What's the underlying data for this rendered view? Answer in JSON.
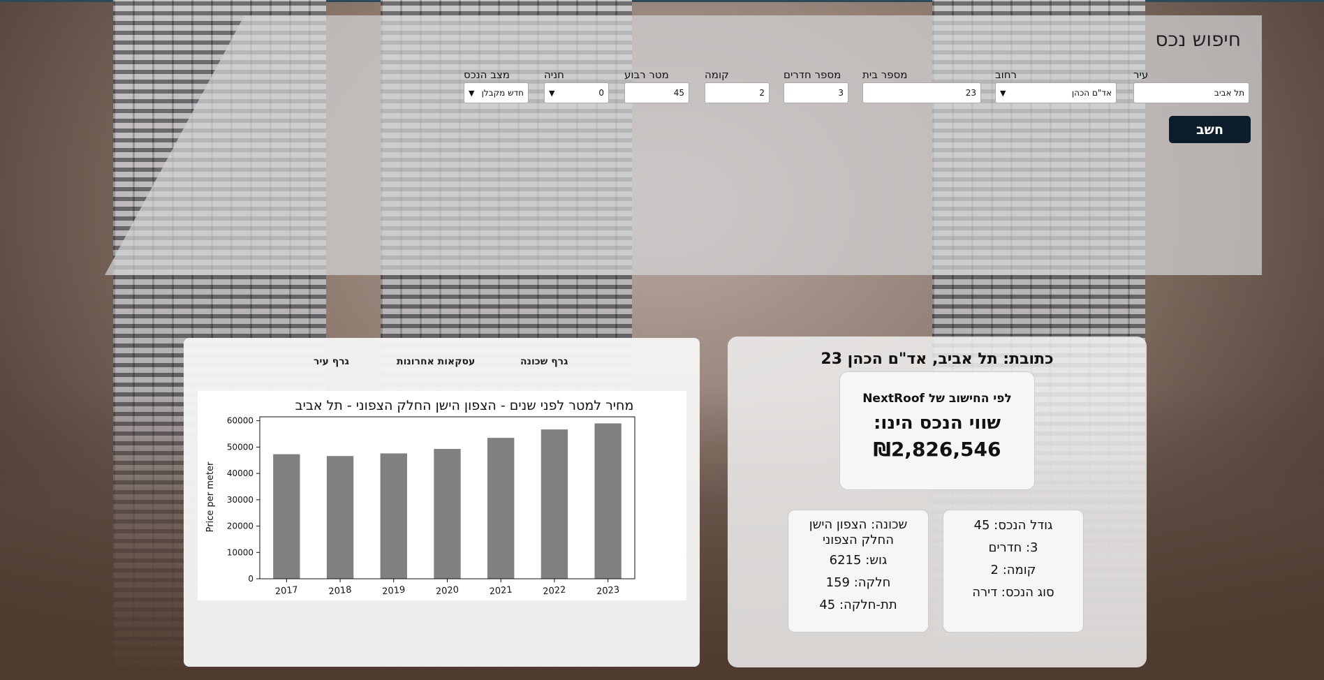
{
  "search": {
    "title": "חיפוש נכס",
    "fields": [
      {
        "label": "עיר",
        "value": "תל אביב"
      },
      {
        "label": "רחוב",
        "value": "אד\"ם הכהן"
      },
      {
        "label": "מספר בית",
        "value": "23"
      },
      {
        "label": "מספר חדרים",
        "value": "3"
      },
      {
        "label": "קומה",
        "value": "2"
      },
      {
        "label": "מטר רבוע",
        "value": "45"
      },
      {
        "label": "חניה",
        "value": "0"
      },
      {
        "label": "מצב הנכס",
        "value": "חדש מקבלן"
      }
    ],
    "calc_label": "חשב"
  },
  "tabs": [
    "גרף שכונה",
    "עסקאות אחרונות",
    "גרף עיר"
  ],
  "chart_data": {
    "type": "bar",
    "title": "מחיר למטר לפני שנים - הצפון הישן החלק הצפוני - תל אביב",
    "xlabel": "",
    "ylabel": "Price per meter",
    "categories": [
      "2017",
      "2018",
      "2019",
      "2020",
      "2021",
      "2022",
      "2023"
    ],
    "values": [
      47300,
      46600,
      47600,
      49300,
      53500,
      56700,
      59000
    ],
    "yticks": [
      "0",
      "10000",
      "20000",
      "30000",
      "40000",
      "50000",
      "60000"
    ],
    "ylim": [
      0,
      61500
    ],
    "bar_color": "#808080"
  },
  "result": {
    "address": "כתובת: תל אביב, אד\"ם הכהן 23",
    "calc_line": "לפי החישוב של NextRoof",
    "value_label": "שווי הנכס הינו:",
    "value": "₪2,826,546",
    "details_left": [
      "שכונה: הצפון הישן החלק הצפוני",
      "גוש: 6215",
      "חלקה: 159",
      "תת-חלקה: 45"
    ],
    "details_right": [
      "גודל הנכס: 45",
      "3: חדרים",
      "קומה: 2",
      "סוג הנכס: דירה"
    ]
  },
  "colors": {
    "button": "#0c1c2a",
    "panel": "#d2d2d4"
  }
}
